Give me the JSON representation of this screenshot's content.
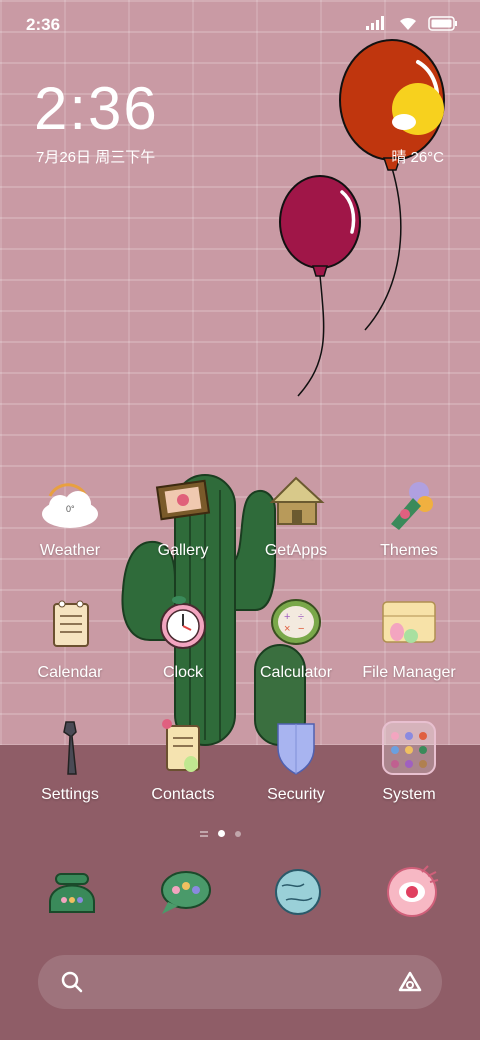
{
  "status_bar": {
    "time": "2:36",
    "icons": [
      "signal-icon",
      "wifi-icon",
      "battery-icon"
    ]
  },
  "lock_widget": {
    "clock": "2:36",
    "date": "7月26日 周三下午",
    "weather": "晴 26°C",
    "weather_badge": "0°"
  },
  "apps": [
    {
      "label": "Weather",
      "icon": "weather-cloud-icon"
    },
    {
      "label": "Gallery",
      "icon": "picture-frame-icon"
    },
    {
      "label": "GetApps",
      "icon": "hut-icon"
    },
    {
      "label": "Themes",
      "icon": "paint-brush-icon"
    },
    {
      "label": "Calendar",
      "icon": "notepad-icon"
    },
    {
      "label": "Clock",
      "icon": "alarm-clock-icon"
    },
    {
      "label": "Calculator",
      "icon": "calculator-icon"
    },
    {
      "label": "File Manager",
      "icon": "folder-icon"
    },
    {
      "label": "Settings",
      "icon": "wrench-icon"
    },
    {
      "label": "Contacts",
      "icon": "contacts-notebook-icon"
    },
    {
      "label": "Security",
      "icon": "shield-icon"
    },
    {
      "label": "System",
      "icon": "system-folder-icon"
    }
  ],
  "page_indicator": {
    "pages": 2,
    "active": 1
  },
  "dock": [
    {
      "icon": "phone-icon"
    },
    {
      "icon": "messages-icon"
    },
    {
      "icon": "browser-globe-icon"
    },
    {
      "icon": "camera-eye-icon"
    }
  ],
  "search": {
    "left_icon": "search-icon",
    "right_icon": "assistant-icon"
  },
  "colors": {
    "wall": "#c99aa4",
    "floor": "#8f5d67",
    "cactus": "#2f6b3a",
    "balloon_red": "#c0360e",
    "balloon_magenta": "#a01648"
  }
}
